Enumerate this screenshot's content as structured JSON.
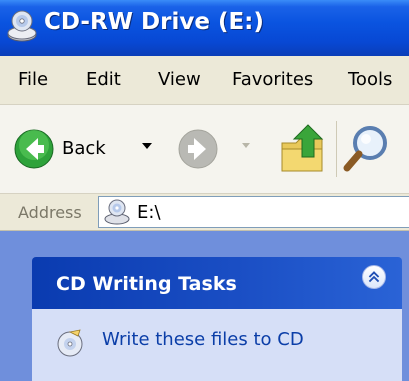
{
  "window": {
    "title": "CD-RW Drive (E:)",
    "icon": "cd-drive-icon"
  },
  "menubar": {
    "items": [
      "File",
      "Edit",
      "View",
      "Favorites",
      "Tools"
    ]
  },
  "toolbar": {
    "back_label": "Back",
    "icons": [
      "back-arrow-icon",
      "forward-arrow-icon",
      "up-folder-icon",
      "search-icon"
    ]
  },
  "address": {
    "label": "Address",
    "value": "E:\\",
    "icon": "cd-drive-icon"
  },
  "tasks": {
    "title": "CD Writing Tasks",
    "items": [
      {
        "label": "Write these files to CD",
        "icon": "write-cd-icon"
      }
    ]
  },
  "colors": {
    "title_bar": "#0a54e0",
    "task_header": "#0a3bb0",
    "task_body": "#d6dff7",
    "pane_bg": "#6f8fdc"
  }
}
